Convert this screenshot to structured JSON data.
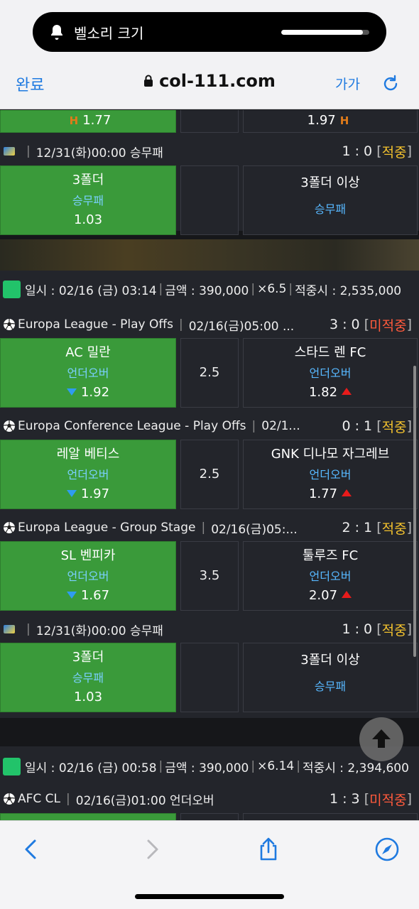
{
  "status": {
    "volume_label": "벨소리 크기",
    "volume_level": 0.93
  },
  "addressbar": {
    "done_label": "완료",
    "url": "col-111.com",
    "text_size_label": "가가"
  },
  "partial_top": {
    "home_odd": "1.77",
    "away_odd": "1.97",
    "h_mark": "H"
  },
  "card1_tail": {
    "match": {
      "datetime": "12/31(화)00:00 승무패",
      "score": "1 : 0",
      "result": "적중"
    },
    "home": {
      "team": "3폴더",
      "market": "승무패",
      "odd": "1.03"
    },
    "away": {
      "team": "3폴더 이상",
      "market": "승무패"
    }
  },
  "card2": {
    "header": {
      "date": "일시 : 02/16 (금) 03:14",
      "amount": "금액 : 390,000",
      "multiplier": "×6.5",
      "payout": "적중시 : 2,535,000"
    },
    "matches": [
      {
        "league": "Europa League - Play Offs",
        "datetime": "02/16(금)05:00 ...",
        "score": "3 : 0",
        "result": "미적중",
        "home": {
          "team": "AC 밀란",
          "market": "언더오버",
          "odd": "1.92"
        },
        "handicap": "2.5",
        "away": {
          "team": "스타드 렌 FC",
          "market": "언더오버",
          "odd": "1.82"
        }
      },
      {
        "league": "Europa Conference League - Play Offs",
        "datetime": "02/1...",
        "score": "0 : 1",
        "result": "적중",
        "home": {
          "team": "레알 베티스",
          "market": "언더오버",
          "odd": "1.97"
        },
        "handicap": "2.5",
        "away": {
          "team": "GNK 디나모 자그레브",
          "market": "언더오버",
          "odd": "1.77"
        }
      },
      {
        "league": "Europa League - Group Stage",
        "datetime": "02/16(금)05:...",
        "score": "2 : 1",
        "result": "적중",
        "home": {
          "team": "SL 벤피카",
          "market": "언더오버",
          "odd": "1.67"
        },
        "handicap": "3.5",
        "away": {
          "team": "툴루즈 FC",
          "market": "언더오버",
          "odd": "2.07"
        }
      },
      {
        "datetime": "12/31(화)00:00 승무패",
        "score": "1 : 0",
        "result": "적중",
        "home": {
          "team": "3폴더",
          "market": "승무패",
          "odd": "1.03"
        },
        "away": {
          "team": "3폴더 이상",
          "market": "승무패"
        }
      }
    ]
  },
  "card3": {
    "header": {
      "date": "일시 : 02/16 (금) 00:58",
      "amount": "금액 : 390,000",
      "multiplier": "×6.14",
      "payout": "적중시 : 2,394,600"
    },
    "match": {
      "league": "AFC CL",
      "datetime": "02/16(금)01:00 언더오버",
      "score": "1 : 3",
      "result": "미적중"
    }
  },
  "icons": {
    "bell": "bell-icon",
    "lock": "lock-icon",
    "reload": "reload-icon",
    "back": "back-icon",
    "forward": "forward-icon",
    "share": "share-icon",
    "compass": "compass-icon",
    "scroll_top": "arrow-up-icon",
    "soccer": "soccer-ball-icon"
  },
  "colors": {
    "win_box": "#3a9a3a",
    "hit": "#f2c12e",
    "miss": "#ff5a3c",
    "market": "#57b8ff",
    "accent": "#1f7ae0"
  }
}
